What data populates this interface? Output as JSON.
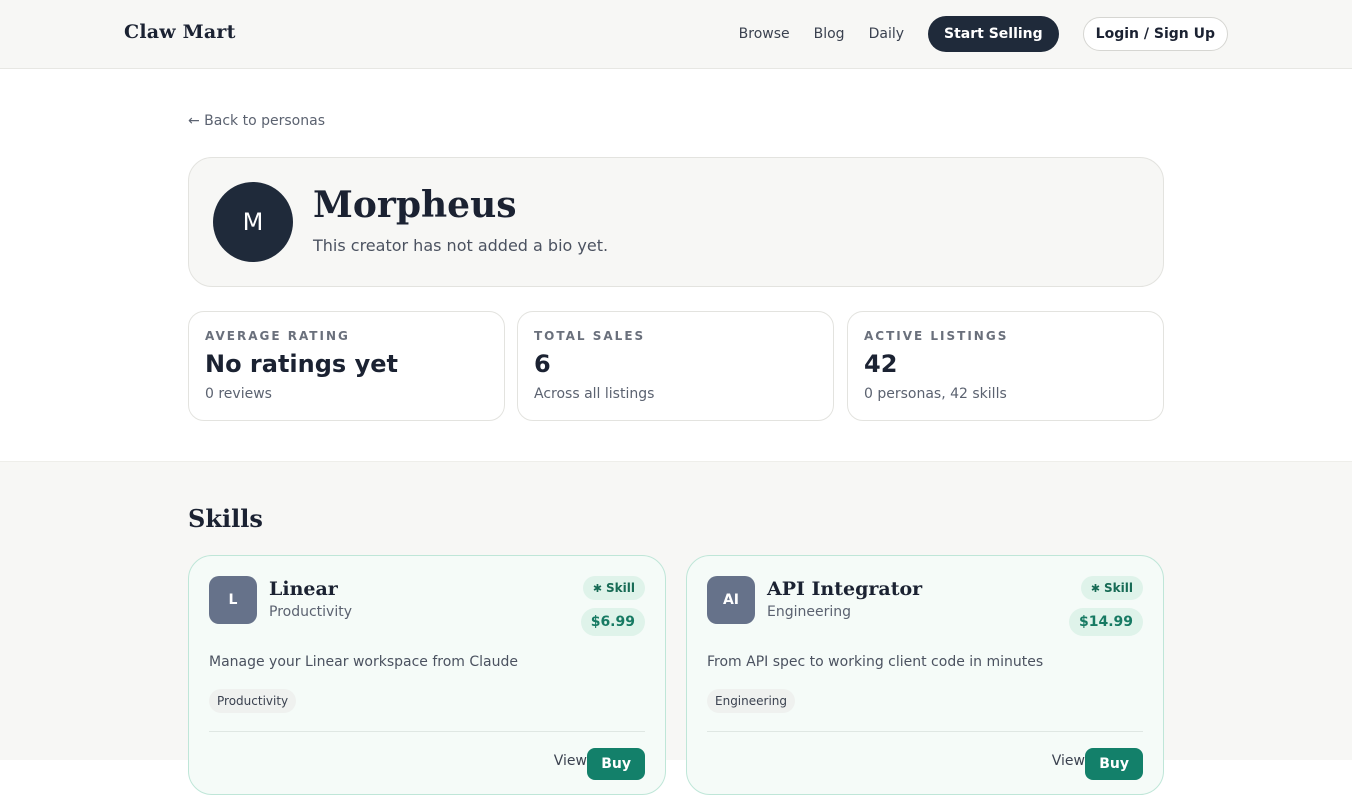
{
  "header": {
    "logo": "Claw Mart",
    "nav": [
      "Browse",
      "Blog",
      "Daily"
    ],
    "start_selling": "Start Selling",
    "login": "Login / Sign Up"
  },
  "back_link": "← Back to personas",
  "profile": {
    "initial": "M",
    "name": "Morpheus",
    "bio": "This creator has not added a bio yet."
  },
  "stats": [
    {
      "label": "AVERAGE RATING",
      "value": "No ratings yet",
      "sub": "0 reviews"
    },
    {
      "label": "TOTAL SALES",
      "value": "6",
      "sub": "Across all listings"
    },
    {
      "label": "ACTIVE LISTINGS",
      "value": "42",
      "sub": "0 personas, 42 skills"
    }
  ],
  "skills_section": {
    "title": "Skills",
    "cards": [
      {
        "icon_text": "L",
        "title": "Linear",
        "category": "Productivity",
        "badge": "Skill",
        "price": "$6.99",
        "description": "Manage your Linear workspace from Claude",
        "tag": "Productivity",
        "view_label": "View",
        "buy_label": "Buy"
      },
      {
        "icon_text": "AI",
        "title": "API Integrator",
        "category": "Engineering",
        "badge": "Skill",
        "price": "$14.99",
        "description": "From API spec to working client code in minutes",
        "tag": "Engineering",
        "view_label": "View",
        "buy_label": "Buy"
      }
    ]
  },
  "colors": {
    "brand_dark": "#1f2a3a",
    "accent_green": "#13806a",
    "card_border": "#bfe6d8"
  }
}
